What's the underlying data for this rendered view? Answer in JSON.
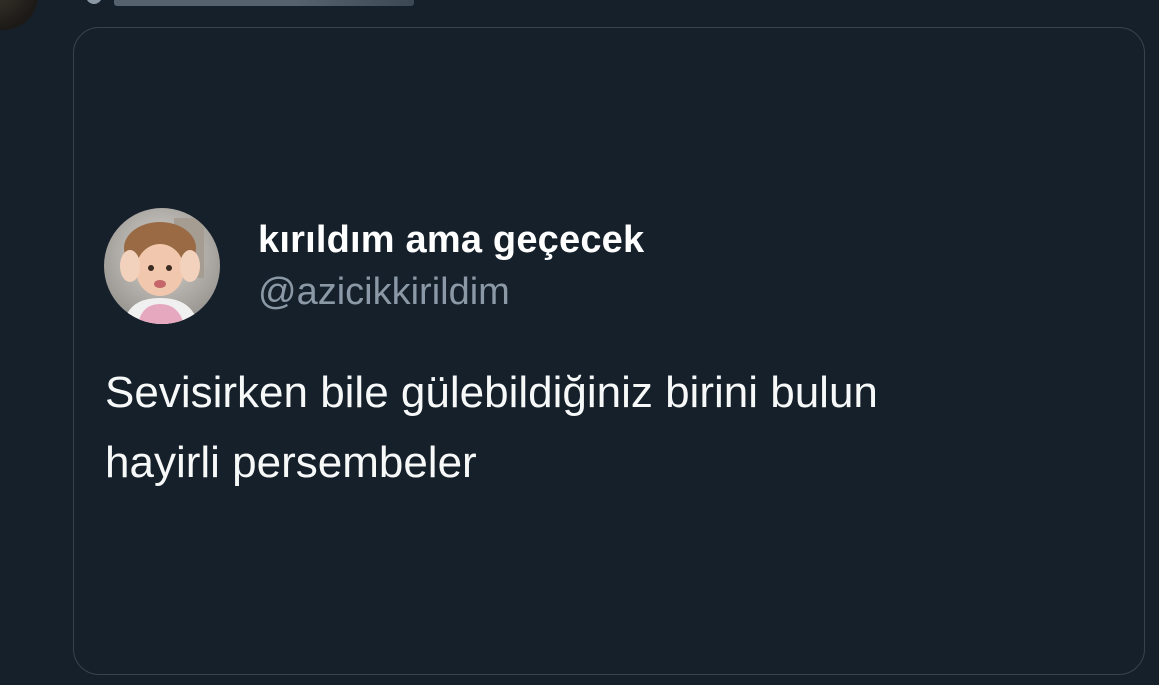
{
  "colors": {
    "background": "#15202b",
    "card_border": "#38444d",
    "primary_text": "#f7f9f9",
    "secondary_text": "#8b98a5"
  },
  "quoted_tweet": {
    "author": {
      "display_name": "kırıldım ama geçecek",
      "handle": "@azicikkirildim",
      "avatar": "baby-photo-avatar"
    },
    "text_lines": [
      "Sevisirken bile gülebildiğiniz birini bulun",
      "hayirli persembeler"
    ]
  }
}
